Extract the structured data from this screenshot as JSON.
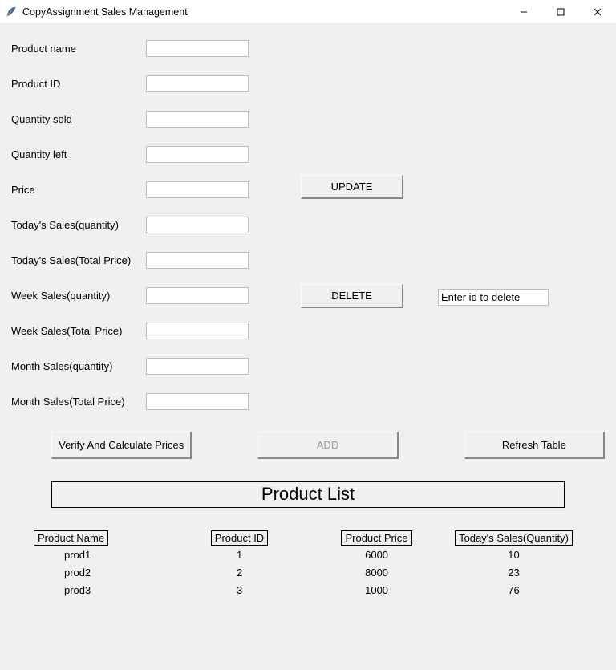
{
  "window": {
    "title": "CopyAssignment Sales Management"
  },
  "form": {
    "product_name_label": "Product name",
    "product_name_value": "",
    "product_id_label": "Product ID",
    "product_id_value": "",
    "quantity_sold_label": "Quantity sold",
    "quantity_sold_value": "",
    "quantity_left_label": "Quantity left",
    "quantity_left_value": "",
    "price_label": "Price",
    "price_value": "",
    "todays_sales_qty_label": "Today's Sales(quantity)",
    "todays_sales_qty_value": "",
    "todays_sales_total_label": "Today's Sales(Total Price)",
    "todays_sales_total_value": "",
    "week_sales_qty_label": "Week Sales(quantity)",
    "week_sales_qty_value": "",
    "week_sales_total_label": "Week Sales(Total Price)",
    "week_sales_total_value": "",
    "month_sales_qty_label": "Month Sales(quantity)",
    "month_sales_qty_value": "",
    "month_sales_total_label": "Month Sales(Total Price)",
    "month_sales_total_value": ""
  },
  "buttons": {
    "update": "UPDATE",
    "delete": "DELETE",
    "verify": "Verify And Calculate Prices",
    "add": "ADD",
    "refresh": "Refresh Table"
  },
  "delete_input": {
    "placeholder": "Enter id to delete",
    "value": "Enter id to delete"
  },
  "list": {
    "heading": "Product List",
    "columns": {
      "name": "Product Name",
      "id": "Product ID",
      "price": "Product Price",
      "todays_qty": "Today's Sales(Quantity)"
    },
    "rows": [
      {
        "name": "prod1",
        "id": "1",
        "price": "6000",
        "todays_qty": "10"
      },
      {
        "name": "prod2",
        "id": "2",
        "price": "8000",
        "todays_qty": "23"
      },
      {
        "name": "prod3",
        "id": "3",
        "price": "1000",
        "todays_qty": "76"
      }
    ]
  }
}
